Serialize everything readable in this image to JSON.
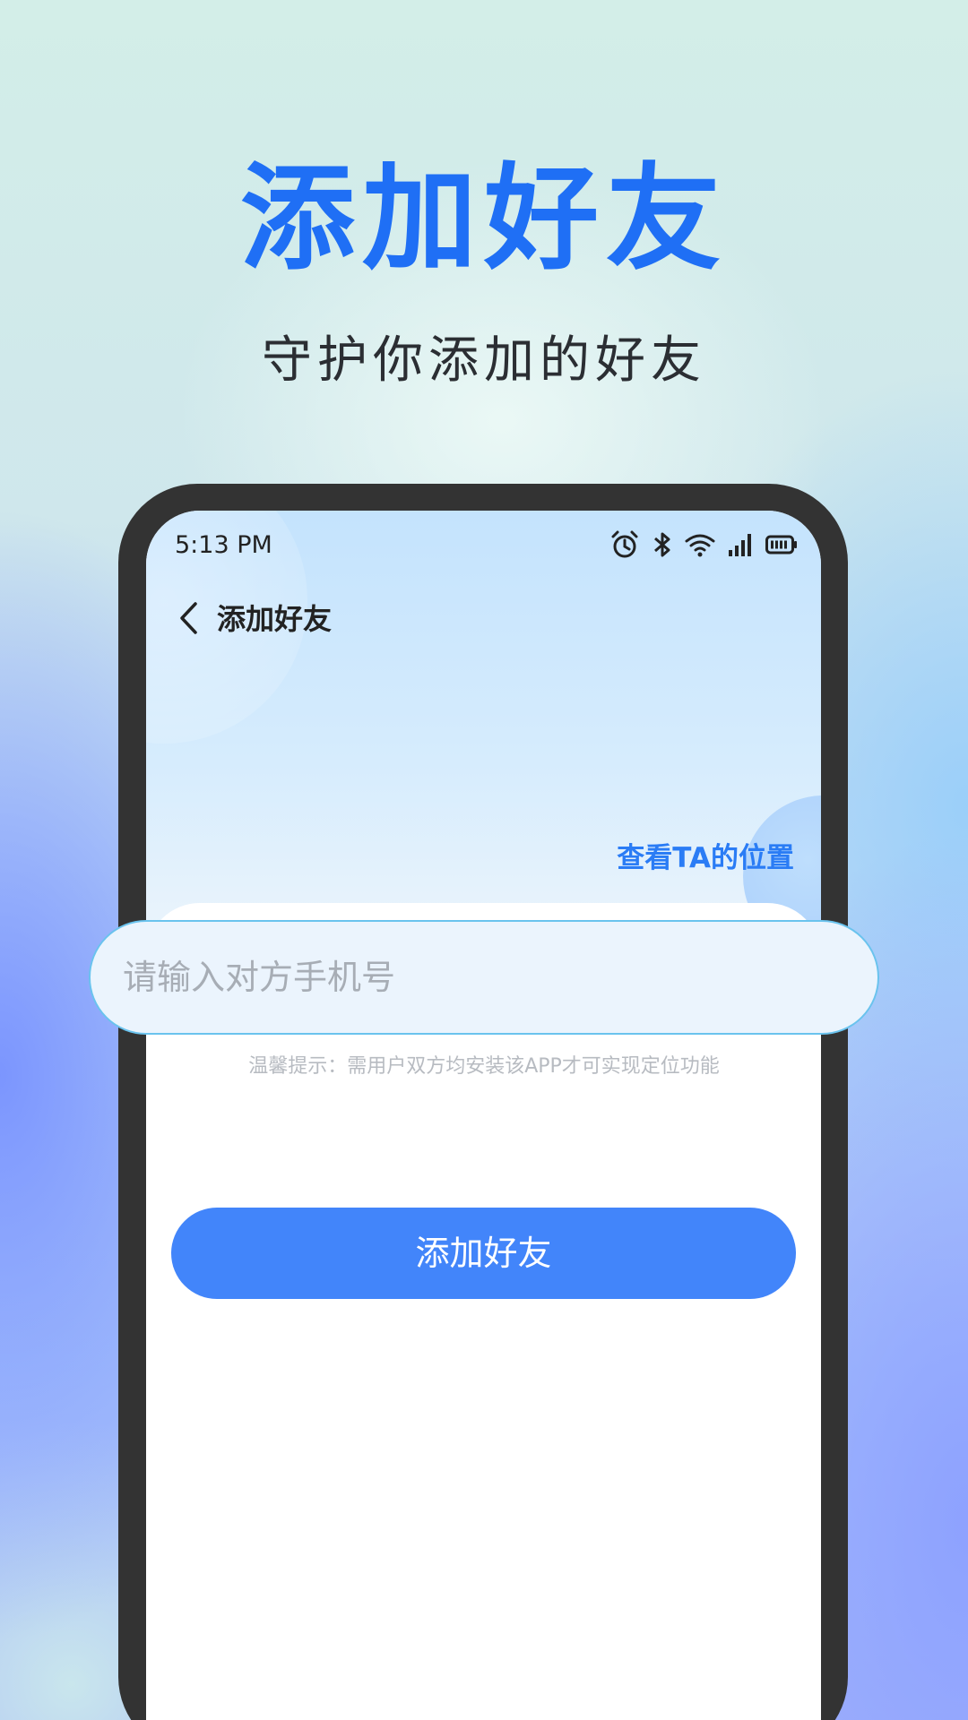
{
  "hero": {
    "title": "添加好友",
    "subtitle": "守护你添加的好友"
  },
  "status_bar": {
    "time": "5:13 PM",
    "icons": [
      "alarm-icon",
      "bluetooth-icon",
      "wifi-icon",
      "signal-icon",
      "battery-icon"
    ]
  },
  "nav": {
    "back_icon": "chevron-left-icon",
    "title": "添加好友"
  },
  "view_location": {
    "label": "查看TA的位置"
  },
  "form": {
    "phone_placeholder": "请输入对方手机号",
    "phone_value": "",
    "tip": "温馨提示：需用户双方均安装该APP才可实现定位功能",
    "submit_label": "添加好友"
  },
  "colors": {
    "accent": "#1f6ff5",
    "button": "#4285fa",
    "link": "#2a7cf5",
    "input_border": "#6ac3ee",
    "phone_frame": "#333333"
  }
}
